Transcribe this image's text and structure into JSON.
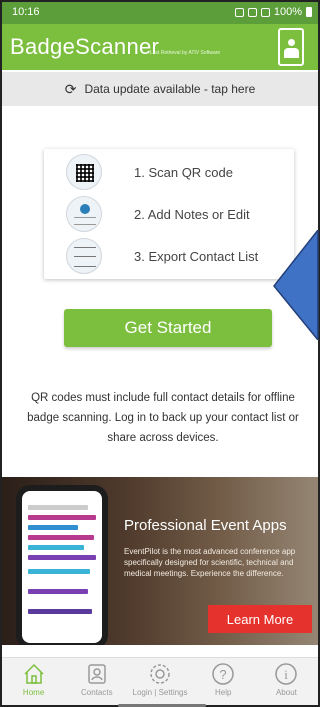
{
  "status_bar": {
    "time": "10:16",
    "battery": "100%"
  },
  "header": {
    "title": "BadgeScanner",
    "tagline": "Last Retrieval by ATIV Software"
  },
  "banner": {
    "text": "Data update available - tap here"
  },
  "steps": [
    {
      "label": "1. Scan QR code"
    },
    {
      "label": "2. Add Notes or Edit"
    },
    {
      "label": "3. Export Contact List"
    }
  ],
  "cta": {
    "label": "Get Started"
  },
  "info": {
    "text": "QR codes must include full contact details for offline badge scanning. Log in to back up your contact list or share across devices."
  },
  "promo": {
    "title": "Professional Event Apps",
    "description": "EventPilot is the most advanced conference app specifically designed for scientific, technical and medical meetings. Experience the difference.",
    "button": "Learn More"
  },
  "nav": [
    {
      "label": "Home",
      "icon": "home-icon",
      "active": true
    },
    {
      "label": "Contacts",
      "icon": "contacts-icon",
      "active": false
    },
    {
      "label": "Login | Settings",
      "icon": "gear-icon",
      "active": false
    },
    {
      "label": "Help",
      "icon": "help-icon",
      "active": false
    },
    {
      "label": "About",
      "icon": "info-icon",
      "active": false
    }
  ],
  "colors": {
    "brand_green": "#7cbf3f",
    "status_green": "#5c9e3a",
    "promo_red": "#e5322d",
    "arrow_blue": "#3f72c4"
  }
}
